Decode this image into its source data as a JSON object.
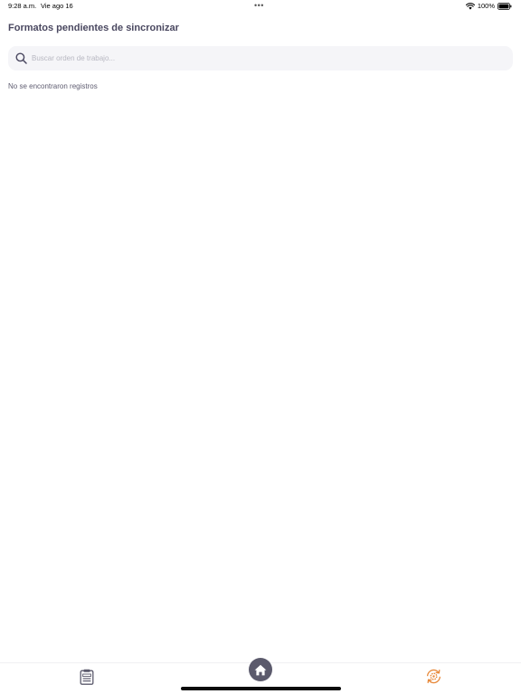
{
  "status_bar": {
    "time": "9:28 a.m.",
    "date": "Vie ago 16",
    "dots": "•••",
    "battery_percent": "100%",
    "icons": [
      "wifi-icon",
      "battery-icon"
    ]
  },
  "header": {
    "title": "Formatos pendientes de sincronizar"
  },
  "search": {
    "placeholder": "Buscar orden de trabajo...",
    "value": "",
    "icon": "search-icon"
  },
  "list": {
    "empty_message": "No se encontraron registros"
  },
  "tab_bar": {
    "items": [
      {
        "icon": "clipboard-icon",
        "active": false
      },
      {
        "icon": "home-icon",
        "active": true
      },
      {
        "icon": "sync-gear-icon",
        "active": false
      }
    ]
  },
  "colors": {
    "title": "#4a4860",
    "search_background": "#f5f5f8",
    "home_button": "#5b5a6c",
    "sync_accent": "#e8893a"
  }
}
